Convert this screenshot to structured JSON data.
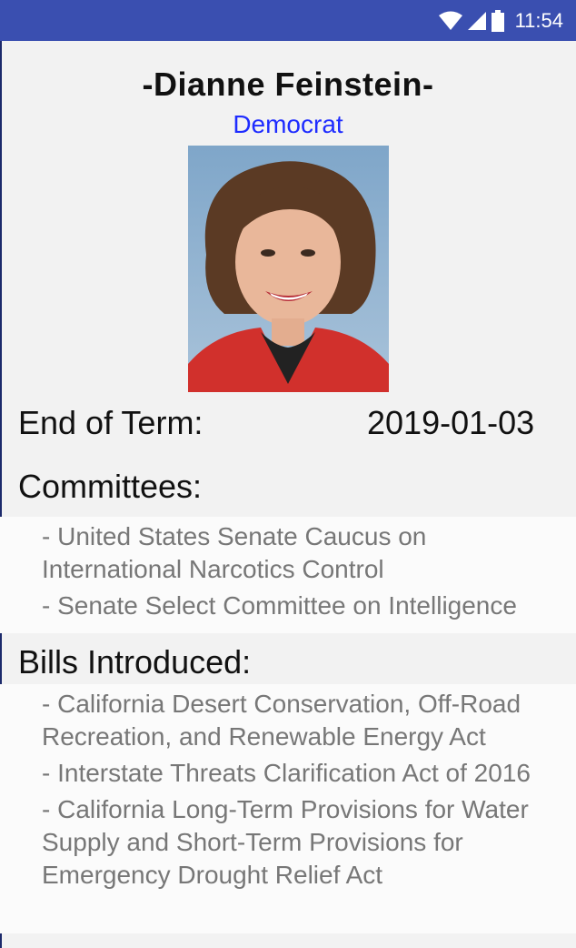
{
  "status_bar": {
    "time": "11:54",
    "icons": [
      "wifi-icon",
      "signal-icon",
      "battery-icon"
    ],
    "background": "#3a4fb0"
  },
  "legislator": {
    "name": "-Dianne Feinstein-",
    "party": "Democrat",
    "party_color": "#1e2cff",
    "end_of_term_label": "End of Term:",
    "end_of_term_value": "2019-01-03"
  },
  "committees": {
    "title": "Committees:",
    "items": [
      "- United States Senate Caucus on International Narcotics Control",
      "- Senate Select Committee on Intelligence"
    ]
  },
  "bills": {
    "title": "Bills Introduced:",
    "items": [
      "- California Desert Conservation, Off-Road Recreation, and Renewable Energy Act",
      "- Interstate Threats Clarification Act of 2016",
      "- California Long-Term Provisions for Water Supply and Short-Term Provisions for Emergency Drought Relief Act"
    ]
  }
}
